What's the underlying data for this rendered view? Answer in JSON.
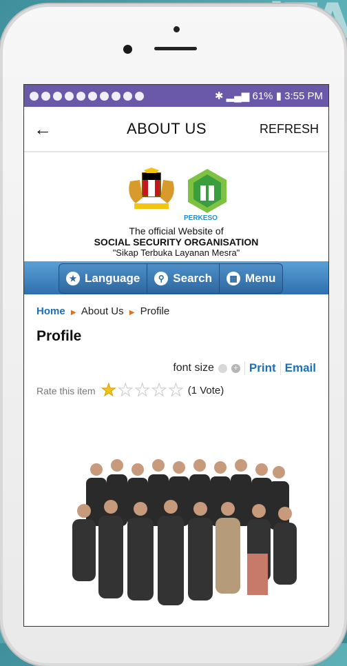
{
  "status_bar": {
    "battery": "61%",
    "time": "3:55 PM"
  },
  "app_bar": {
    "title": "ABOUT US",
    "refresh_label": "REFRESH",
    "back_icon": "arrow-left-icon"
  },
  "site_header": {
    "logo_text": "PERKESO",
    "official_line": "The official Website of",
    "organisation": "SOCIAL SECURITY ORGANISATION",
    "slogan": "\"Sikap Terbuka Layanan Mesra\""
  },
  "nav": {
    "items": [
      {
        "label": "Language",
        "icon": "star-icon"
      },
      {
        "label": "Search",
        "icon": "search-icon"
      },
      {
        "label": "Menu",
        "icon": "grid-icon"
      }
    ],
    "accent": "#2f6fae"
  },
  "breadcrumb": {
    "items": [
      "Home",
      "About Us",
      "Profile"
    ]
  },
  "page": {
    "title": "Profile",
    "font_size_label": "font size",
    "print_label": "Print",
    "email_label": "Email",
    "rate_label": "Rate this item",
    "rating_value": 1,
    "rating_max": 5,
    "votes_label": "(1 Vote)"
  },
  "colors": {
    "status_bar": "#6a58a8",
    "link": "#1b6fb8",
    "star": "#f3c21b"
  }
}
